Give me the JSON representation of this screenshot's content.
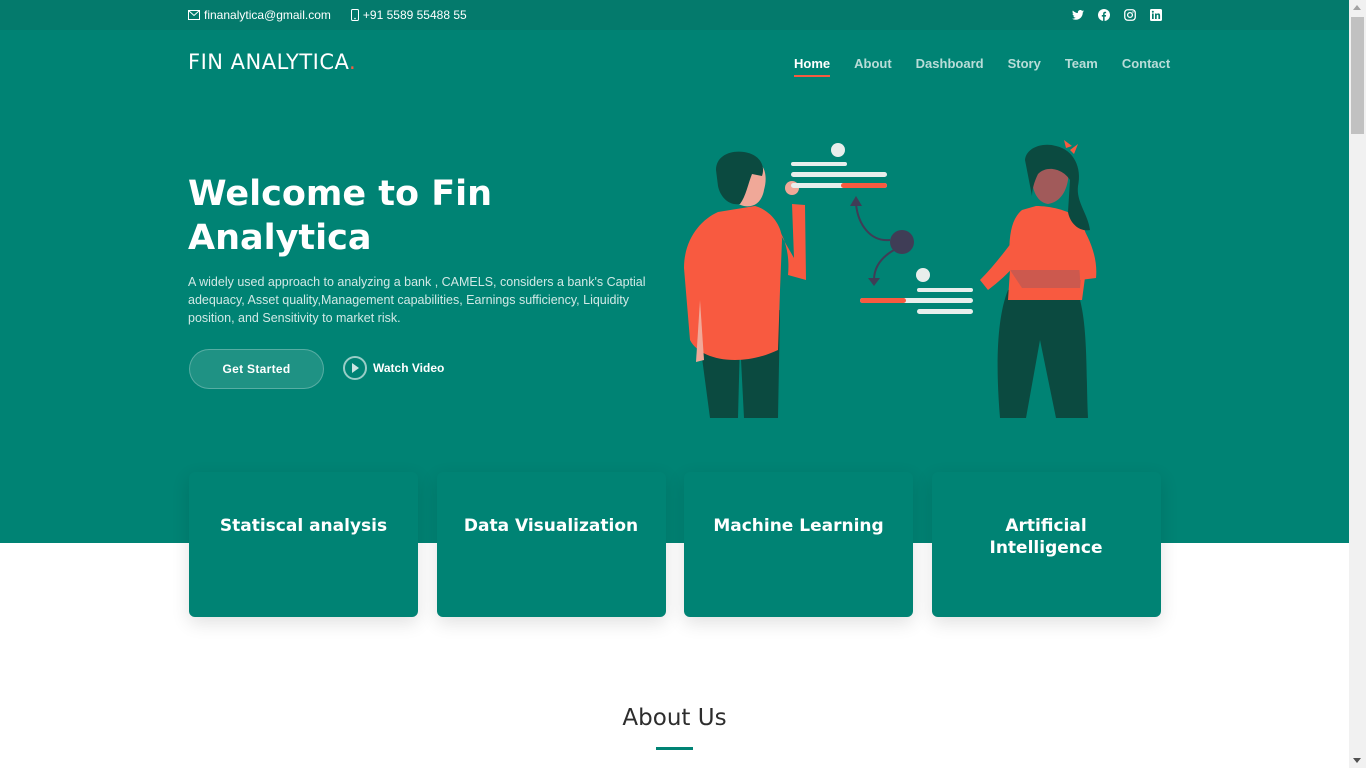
{
  "topbar": {
    "email": "finanalytica@gmail.com",
    "phone": "+91 5589 55488 55",
    "social": [
      "twitter-icon",
      "facebook-icon",
      "instagram-icon",
      "linkedin-icon"
    ]
  },
  "brand": {
    "name": "FIN ANALYTICA",
    "dot": "."
  },
  "nav": {
    "items": [
      {
        "label": "Home",
        "active": true
      },
      {
        "label": "About"
      },
      {
        "label": "Dashboard"
      },
      {
        "label": "Story"
      },
      {
        "label": "Team"
      },
      {
        "label": "Contact"
      }
    ]
  },
  "hero": {
    "title": "Welcome to Fin Analytica",
    "description": "A widely used approach to analyzing a bank , CAMELS, considers a bank's Captial adequacy, Asset quality,Management capabilities, Earnings sufficiency, Liquidity position, and Sensitivity to market risk.",
    "cta_label": "Get Started",
    "video_label": "Watch Video"
  },
  "features": [
    {
      "label": "Statiscal analysis"
    },
    {
      "label": "Data Visualization"
    },
    {
      "label": "Machine Learning"
    },
    {
      "label": "Artificial Intelligence"
    }
  ],
  "about": {
    "title": "About Us"
  },
  "colors": {
    "primary": "#008374",
    "topbar": "#047a6c",
    "accent": "#f85a40"
  }
}
